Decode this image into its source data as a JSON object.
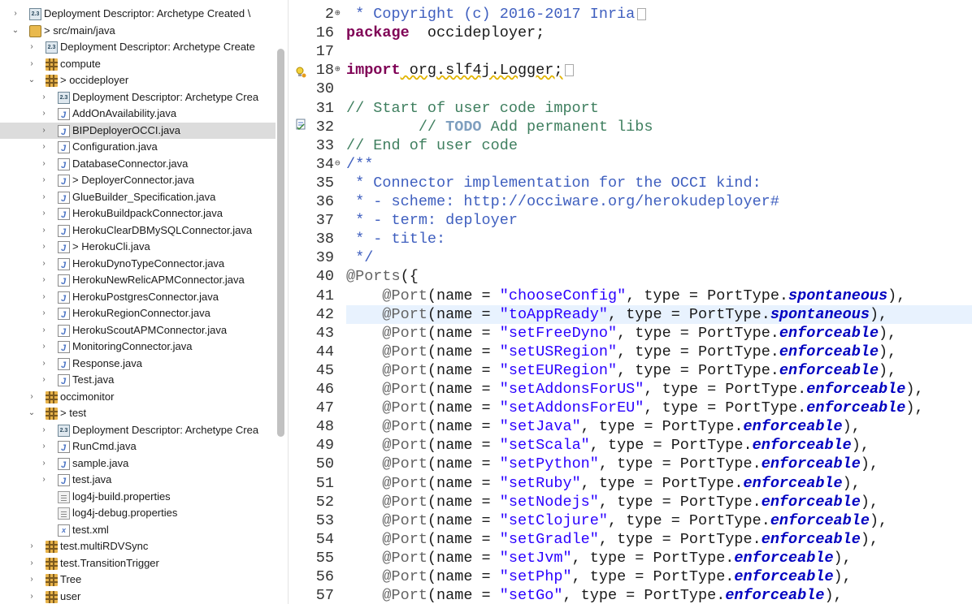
{
  "tree": {
    "items": [
      {
        "depth": 0,
        "chev": "›",
        "icon": "dd",
        "label": "Deployment Descriptor: Archetype Created \\"
      },
      {
        "depth": 0,
        "chev": "⌄",
        "icon": "srcfolder",
        "label": "> src/main/java"
      },
      {
        "depth": 1,
        "chev": "›",
        "icon": "dd",
        "label": "Deployment Descriptor: Archetype Create"
      },
      {
        "depth": 1,
        "chev": "›",
        "icon": "pkg",
        "label": "compute"
      },
      {
        "depth": 1,
        "chev": "⌄",
        "icon": "pkg",
        "label": "> occideployer"
      },
      {
        "depth": 2,
        "chev": "›",
        "icon": "dd",
        "label": "Deployment Descriptor: Archetype Crea"
      },
      {
        "depth": 2,
        "chev": "›",
        "icon": "java",
        "label": "AddOnAvailability.java"
      },
      {
        "depth": 2,
        "chev": "›",
        "icon": "java",
        "label": "BIPDeployerOCCI.java",
        "selected": true
      },
      {
        "depth": 2,
        "chev": "›",
        "icon": "java",
        "label": "Configuration.java"
      },
      {
        "depth": 2,
        "chev": "›",
        "icon": "java",
        "label": "DatabaseConnector.java"
      },
      {
        "depth": 2,
        "chev": "›",
        "icon": "java",
        "label": "> DeployerConnector.java"
      },
      {
        "depth": 2,
        "chev": "›",
        "icon": "java",
        "label": "GlueBuilder_Specification.java"
      },
      {
        "depth": 2,
        "chev": "›",
        "icon": "java",
        "label": "HerokuBuildpackConnector.java"
      },
      {
        "depth": 2,
        "chev": "›",
        "icon": "java",
        "label": "HerokuClearDBMySQLConnector.java"
      },
      {
        "depth": 2,
        "chev": "›",
        "icon": "java",
        "label": "> HerokuCli.java"
      },
      {
        "depth": 2,
        "chev": "›",
        "icon": "java",
        "label": "HerokuDynoTypeConnector.java"
      },
      {
        "depth": 2,
        "chev": "›",
        "icon": "java",
        "label": "HerokuNewRelicAPMConnector.java"
      },
      {
        "depth": 2,
        "chev": "›",
        "icon": "java",
        "label": "HerokuPostgresConnector.java"
      },
      {
        "depth": 2,
        "chev": "›",
        "icon": "java",
        "label": "HerokuRegionConnector.java"
      },
      {
        "depth": 2,
        "chev": "›",
        "icon": "java",
        "label": "HerokuScoutAPMConnector.java"
      },
      {
        "depth": 2,
        "chev": "›",
        "icon": "java",
        "label": "MonitoringConnector.java"
      },
      {
        "depth": 2,
        "chev": "›",
        "icon": "java",
        "label": "Response.java"
      },
      {
        "depth": 2,
        "chev": "›",
        "icon": "java",
        "label": "Test.java"
      },
      {
        "depth": 1,
        "chev": "›",
        "icon": "pkg",
        "label": "occimonitor"
      },
      {
        "depth": 1,
        "chev": "⌄",
        "icon": "pkg",
        "label": "> test"
      },
      {
        "depth": 2,
        "chev": "›",
        "icon": "dd",
        "label": "Deployment Descriptor: Archetype Crea"
      },
      {
        "depth": 2,
        "chev": "›",
        "icon": "java",
        "label": "RunCmd.java"
      },
      {
        "depth": 2,
        "chev": "›",
        "icon": "java",
        "label": "sample.java"
      },
      {
        "depth": 2,
        "chev": "›",
        "icon": "java",
        "label": "test.java"
      },
      {
        "depth": 2,
        "chev": "",
        "icon": "prop",
        "label": "log4j-build.properties"
      },
      {
        "depth": 2,
        "chev": "",
        "icon": "prop",
        "label": "log4j-debug.properties"
      },
      {
        "depth": 2,
        "chev": "",
        "icon": "xml",
        "label": "test.xml"
      },
      {
        "depth": 1,
        "chev": "›",
        "icon": "pkg",
        "label": "test.multiRDVSync"
      },
      {
        "depth": 1,
        "chev": "›",
        "icon": "pkg",
        "label": "test.TransitionTrigger"
      },
      {
        "depth": 1,
        "chev": "›",
        "icon": "pkg",
        "label": "Tree"
      },
      {
        "depth": 1,
        "chev": "›",
        "icon": "pkg",
        "label": "user"
      }
    ]
  },
  "editor": {
    "lines": [
      {
        "n": "2",
        "fold": "⊕",
        "segs": [
          [
            "jd",
            " * Copyright (c) 2016-2017 Inria"
          ]
        ],
        "box": true
      },
      {
        "n": "16",
        "segs": [
          [
            "kw",
            "package"
          ],
          [
            "",
            "  occideployer;"
          ]
        ]
      },
      {
        "n": "17",
        "segs": []
      },
      {
        "n": "18",
        "fold": "⊕",
        "segs": [
          [
            "kw",
            "import"
          ],
          [
            "warn",
            " org.slf4j.Logger;"
          ]
        ],
        "box": true
      },
      {
        "n": "30",
        "segs": []
      },
      {
        "n": "31",
        "segs": [
          [
            "cm",
            "// Start of user code import"
          ]
        ]
      },
      {
        "n": "32",
        "segs": [
          [
            "cm",
            "        // "
          ],
          [
            "todo",
            "TODO"
          ],
          [
            "cm",
            " Add permanent libs"
          ]
        ]
      },
      {
        "n": "33",
        "segs": [
          [
            "cm",
            "// End of user code"
          ]
        ]
      },
      {
        "n": "34",
        "fold": "⊖",
        "segs": [
          [
            "jd",
            "/**"
          ]
        ]
      },
      {
        "n": "35",
        "segs": [
          [
            "jd",
            " * Connector implementation for the OCCI kind:"
          ]
        ]
      },
      {
        "n": "36",
        "segs": [
          [
            "jd",
            " * - scheme: http://occiware.org/herokudeployer#"
          ]
        ]
      },
      {
        "n": "37",
        "segs": [
          [
            "jd",
            " * - term: deployer"
          ]
        ]
      },
      {
        "n": "38",
        "segs": [
          [
            "jd",
            " * - title:"
          ]
        ]
      },
      {
        "n": "39",
        "segs": [
          [
            "jd",
            " */"
          ]
        ]
      },
      {
        "n": "40",
        "segs": [
          [
            "an",
            "@Ports"
          ],
          [
            "",
            "({"
          ]
        ]
      },
      {
        "n": "41",
        "segs": [
          [
            "an",
            "    @Port"
          ],
          [
            "",
            "(name = "
          ],
          [
            "st",
            "\"chooseConfig\""
          ],
          [
            "",
            ", type = PortType."
          ],
          [
            "it",
            "spontaneous"
          ],
          [
            "",
            "),"
          ]
        ]
      },
      {
        "n": "42",
        "hl": true,
        "segs": [
          [
            "an",
            "    @Port"
          ],
          [
            "",
            "(name = "
          ],
          [
            "st",
            "\"toAppReady\""
          ],
          [
            "",
            ", type = PortType."
          ],
          [
            "it",
            "spontaneous"
          ],
          [
            "",
            "),"
          ]
        ]
      },
      {
        "n": "43",
        "segs": [
          [
            "an",
            "    @Port"
          ],
          [
            "",
            "(name = "
          ],
          [
            "st",
            "\"setFreeDyno\""
          ],
          [
            "",
            ", type = PortType."
          ],
          [
            "it",
            "enforceable"
          ],
          [
            "",
            "),"
          ]
        ]
      },
      {
        "n": "44",
        "segs": [
          [
            "an",
            "    @Port"
          ],
          [
            "",
            "(name = "
          ],
          [
            "st",
            "\"setUSRegion\""
          ],
          [
            "",
            ", type = PortType."
          ],
          [
            "it",
            "enforceable"
          ],
          [
            "",
            "),"
          ]
        ]
      },
      {
        "n": "45",
        "segs": [
          [
            "an",
            "    @Port"
          ],
          [
            "",
            "(name = "
          ],
          [
            "st",
            "\"setEURegion\""
          ],
          [
            "",
            ", type = PortType."
          ],
          [
            "it",
            "enforceable"
          ],
          [
            "",
            "),"
          ]
        ]
      },
      {
        "n": "46",
        "segs": [
          [
            "an",
            "    @Port"
          ],
          [
            "",
            "(name = "
          ],
          [
            "st",
            "\"setAddonsForUS\""
          ],
          [
            "",
            ", type = PortType."
          ],
          [
            "it",
            "enforceable"
          ],
          [
            "",
            "),"
          ]
        ]
      },
      {
        "n": "47",
        "segs": [
          [
            "an",
            "    @Port"
          ],
          [
            "",
            "(name = "
          ],
          [
            "st",
            "\"setAddonsForEU\""
          ],
          [
            "",
            ", type = PortType."
          ],
          [
            "it",
            "enforceable"
          ],
          [
            "",
            "),"
          ]
        ]
      },
      {
        "n": "48",
        "segs": [
          [
            "an",
            "    @Port"
          ],
          [
            "",
            "(name = "
          ],
          [
            "st",
            "\"setJava\""
          ],
          [
            "",
            ", type = PortType."
          ],
          [
            "it",
            "enforceable"
          ],
          [
            "",
            "),"
          ]
        ]
      },
      {
        "n": "49",
        "segs": [
          [
            "an",
            "    @Port"
          ],
          [
            "",
            "(name = "
          ],
          [
            "st",
            "\"setScala\""
          ],
          [
            "",
            ", type = PortType."
          ],
          [
            "it",
            "enforceable"
          ],
          [
            "",
            "),"
          ]
        ]
      },
      {
        "n": "50",
        "segs": [
          [
            "an",
            "    @Port"
          ],
          [
            "",
            "(name = "
          ],
          [
            "st",
            "\"setPython\""
          ],
          [
            "",
            ", type = PortType."
          ],
          [
            "it",
            "enforceable"
          ],
          [
            "",
            "),"
          ]
        ]
      },
      {
        "n": "51",
        "segs": [
          [
            "an",
            "    @Port"
          ],
          [
            "",
            "(name = "
          ],
          [
            "st",
            "\"setRuby\""
          ],
          [
            "",
            ", type = PortType."
          ],
          [
            "it",
            "enforceable"
          ],
          [
            "",
            "),"
          ]
        ]
      },
      {
        "n": "52",
        "segs": [
          [
            "an",
            "    @Port"
          ],
          [
            "",
            "(name = "
          ],
          [
            "st",
            "\"setNodejs\""
          ],
          [
            "",
            ", type = PortType."
          ],
          [
            "it",
            "enforceable"
          ],
          [
            "",
            "),"
          ]
        ]
      },
      {
        "n": "53",
        "segs": [
          [
            "an",
            "    @Port"
          ],
          [
            "",
            "(name = "
          ],
          [
            "st",
            "\"setClojure\""
          ],
          [
            "",
            ", type = PortType."
          ],
          [
            "it",
            "enforceable"
          ],
          [
            "",
            "),"
          ]
        ]
      },
      {
        "n": "54",
        "segs": [
          [
            "an",
            "    @Port"
          ],
          [
            "",
            "(name = "
          ],
          [
            "st",
            "\"setGradle\""
          ],
          [
            "",
            ", type = PortType."
          ],
          [
            "it",
            "enforceable"
          ],
          [
            "",
            "),"
          ]
        ]
      },
      {
        "n": "55",
        "segs": [
          [
            "an",
            "    @Port"
          ],
          [
            "",
            "(name = "
          ],
          [
            "st",
            "\"setJvm\""
          ],
          [
            "",
            ", type = PortType."
          ],
          [
            "it",
            "enforceable"
          ],
          [
            "",
            "),"
          ]
        ]
      },
      {
        "n": "56",
        "segs": [
          [
            "an",
            "    @Port"
          ],
          [
            "",
            "(name = "
          ],
          [
            "st",
            "\"setPhp\""
          ],
          [
            "",
            ", type = PortType."
          ],
          [
            "it",
            "enforceable"
          ],
          [
            "",
            "),"
          ]
        ]
      },
      {
        "n": "57",
        "segs": [
          [
            "an",
            "    @Port"
          ],
          [
            "",
            "(name = "
          ],
          [
            "st",
            "\"setGo\""
          ],
          [
            "",
            ", type = PortType."
          ],
          [
            "it",
            "enforceable"
          ],
          [
            "",
            "),"
          ]
        ]
      }
    ]
  }
}
